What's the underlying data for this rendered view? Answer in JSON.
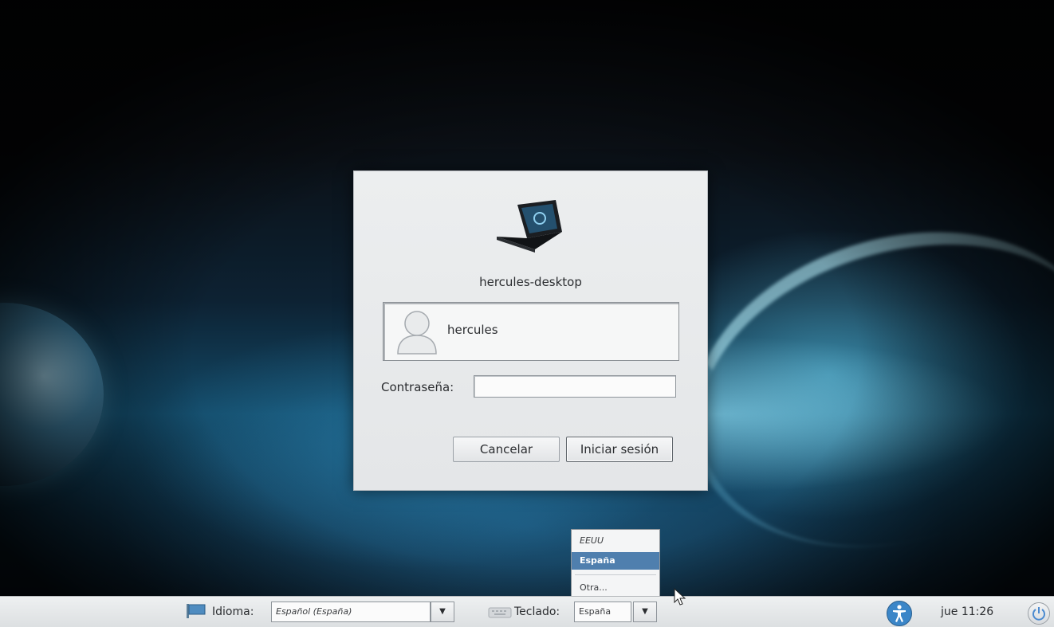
{
  "dialog": {
    "hostname": "hercules-desktop",
    "username": "hercules",
    "password_label": "Contraseña:",
    "password_value": "",
    "cancel_label": "Cancelar",
    "login_label": "Iniciar sesión"
  },
  "keyboard_menu": {
    "items": [
      "EEUU",
      "España",
      "Otra..."
    ],
    "selected": "España"
  },
  "panel": {
    "language_label": "Idioma:",
    "language_value": "Español (España)",
    "keyboard_label": "Teclado:",
    "keyboard_value": "España",
    "clock": "jue 11:26"
  },
  "colors": {
    "dialog_bg": "#e8eaeb",
    "selection": "#4f7fae",
    "panel_bg": "#e4e6e8",
    "accessibility": "#3b86c8"
  },
  "icons": [
    "computer-icon",
    "user-avatar-icon",
    "flag-icon",
    "keyboard-icon",
    "accessibility-icon",
    "power-icon",
    "dropdown-arrow-icon",
    "mouse-cursor-icon"
  ]
}
